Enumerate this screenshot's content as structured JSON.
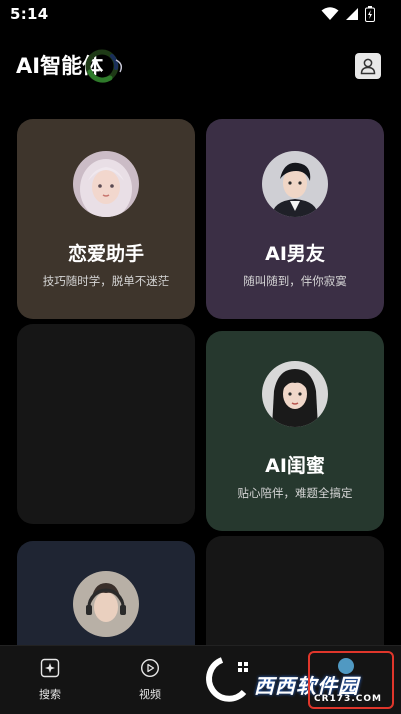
{
  "status_bar": {
    "time": "5:14"
  },
  "header": {
    "title": "AI智能体"
  },
  "cards": [
    {
      "title": "恋爱助手",
      "subtitle": "技巧随时学，脱单不迷茫"
    },
    {
      "title": "AI男友",
      "subtitle": "随叫随到，伴你寂寞"
    },
    {
      "title": "AI闺蜜",
      "subtitle": "贴心陪伴，难题全搞定"
    }
  ],
  "bottom_nav": [
    {
      "label": "搜索",
      "icon": "sparkle-icon"
    },
    {
      "label": "视频",
      "icon": "play-icon"
    }
  ],
  "watermark": {
    "text": "西西软件园",
    "url": "CR173.COM"
  },
  "colors": {
    "card_love": "#3e352c",
    "card_boyfriend": "#3b2f45",
    "card_bestie": "#26382e",
    "card_dark": "#161616",
    "card_navy": "#1f2533",
    "highlight": "#e0362b"
  }
}
